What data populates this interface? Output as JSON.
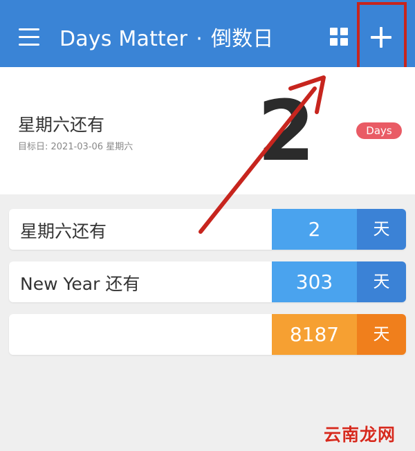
{
  "topbar": {
    "title": "Days Matter",
    "separator": "·",
    "subtitle": "倒数日",
    "menu_icon": "hamburger-menu-icon",
    "grid_icon": "grid-view-icon",
    "add_icon": "plus-icon"
  },
  "hero": {
    "title": "星期六还有",
    "target_date": "目标日: 2021-03-06 星期六",
    "days": "2",
    "badge": "Days"
  },
  "events": [
    {
      "label": "星期六还有",
      "days": "2",
      "unit": "天",
      "color": "#4aa3ee"
    },
    {
      "label": "New Year 还有",
      "days": "303",
      "unit": "天",
      "color": "#4aa3ee"
    },
    {
      "label": "",
      "days": "8187",
      "unit": "天",
      "color": "#f6a032"
    }
  ],
  "annotation": {
    "highlight_color": "#c7251e"
  },
  "watermark": "云南龙网"
}
